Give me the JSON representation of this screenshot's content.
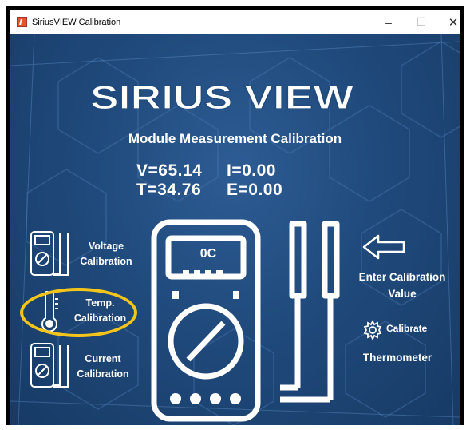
{
  "window": {
    "title": "SiriusVIEW Calibration",
    "minimize": "–",
    "maximize": "☐",
    "close": "✕"
  },
  "header": {
    "logo_text": "SIRIUS VIEW",
    "subtitle": "Module Measurement Calibration"
  },
  "readings": {
    "voltage": "V=65.14",
    "current": "I=0.00",
    "temperature": "T=34.76",
    "energy": "E=0.00"
  },
  "left_menu": {
    "voltage": [
      "Voltage",
      "Calibration"
    ],
    "temp": [
      "Temp.",
      "Calibration"
    ],
    "current": [
      "Current",
      "Calibration"
    ]
  },
  "meter_display": "0C",
  "right_menu": {
    "enter_value": [
      "Enter Calibration",
      "Value"
    ],
    "calibrate": "Calibrate",
    "thermometer": "Thermometer"
  },
  "colors": {
    "background": "#204a7c",
    "highlight_circle": "#f3c41b",
    "text": "#ffffff"
  }
}
